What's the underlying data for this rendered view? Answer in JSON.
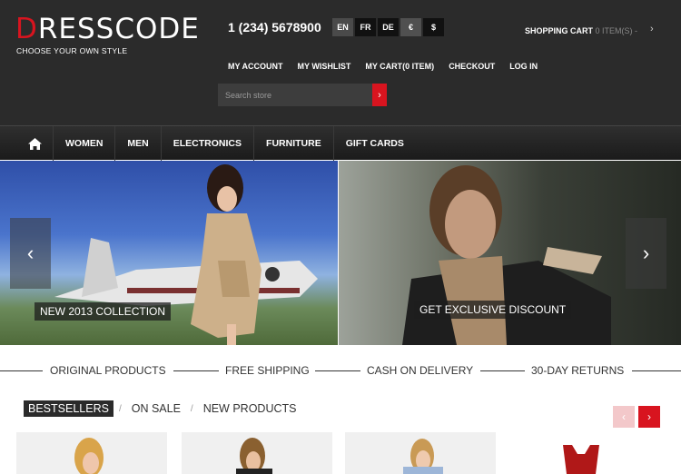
{
  "brand": {
    "logo_first": "D",
    "logo_rest": "RESSCODE",
    "tagline": "CHOOSE YOUR OWN STYLE"
  },
  "header": {
    "phone": "1 (234) 5678900",
    "languages": [
      "EN",
      "FR",
      "DE"
    ],
    "currencies": [
      "€",
      "$"
    ],
    "cart_label": "SHOPPING CART",
    "cart_items": "0 ITEM(S) -",
    "links": [
      "MY ACCOUNT",
      "MY WISHLIST",
      "MY CART(0 ITEM)",
      "CHECKOUT",
      "LOG IN"
    ],
    "search_placeholder": "Search store"
  },
  "nav": {
    "items": [
      "WOMEN",
      "MEN",
      "ELECTRONICS",
      "FURNITURE",
      "GIFT CARDS"
    ]
  },
  "banners": {
    "left_caption": "NEW 2013 COLLECTION",
    "right_caption": "GET EXCLUSIVE DISCOUNT"
  },
  "features": [
    "ORIGINAL PRODUCTS",
    "FREE SHIPPING",
    "CASH ON DELIVERY",
    "30-DAY RETURNS"
  ],
  "product_tabs": [
    "BESTSELLERS",
    "ON SALE",
    "NEW PRODUCTS"
  ],
  "colors": {
    "accent": "#d8141f",
    "header_bg": "#2b2b2b"
  }
}
